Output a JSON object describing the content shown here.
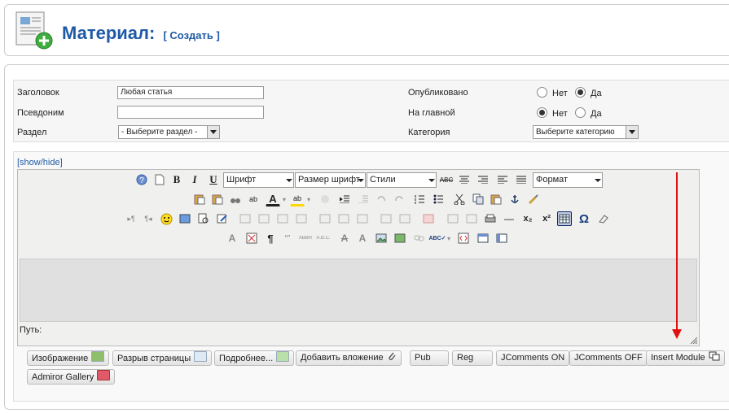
{
  "header": {
    "title": "Материал:",
    "subtitle": "[ Создать ]"
  },
  "form": {
    "title_label": "Заголовок",
    "title_value": "Любая статья",
    "alias_label": "Псевдоним",
    "alias_value": "",
    "section_label": "Раздел",
    "section_value": "- Выберите раздел -",
    "published_label": "Опубликовано",
    "published_no": "Нет",
    "published_yes": "Да",
    "frontpage_label": "На главной",
    "frontpage_no": "Нет",
    "frontpage_yes": "Да",
    "category_label": "Категория",
    "category_value": "Выберите категорию"
  },
  "editor": {
    "showhide": "[show/hide]",
    "font_select": "Шрифт",
    "size_select": "Размер шрифт",
    "styles_select": "Стили",
    "format_select": "Формат",
    "path_label": "Путь:",
    "colors": {
      "accent": "#1f5aa6",
      "arrow": "#e01010"
    }
  },
  "buttons": {
    "image": "Изображение",
    "pagebreak": "Разрыв страницы",
    "readmore": "Подробнее...",
    "attach": "Добавить вложение",
    "pub": "Pub",
    "reg": "Reg",
    "jcomments_on": "JComments ON",
    "jcomments_off": "JComments OFF",
    "insert_module": "Insert Module",
    "admiror": "Admiror Gallery"
  },
  "glyphs": {
    "bold": "B",
    "italic": "I",
    "underline": "U",
    "strike": "ABC",
    "sub": "x₂",
    "sup": "x²",
    "omega": "Ω",
    "pilcrow": "¶",
    "quote": "“”",
    "abbr": "ABBR",
    "acronym": "A.B.C.",
    "attribs": "A",
    "hr": "—",
    "rtl": "▸¶",
    "ltr": "¶◂",
    "a": "A",
    "ab": "ab"
  }
}
